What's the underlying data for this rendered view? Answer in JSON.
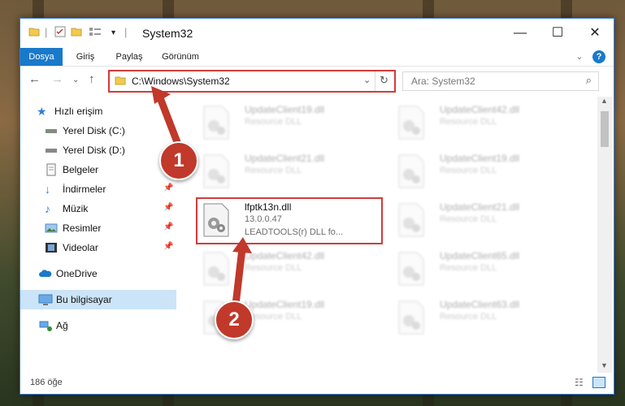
{
  "window": {
    "title": "System32",
    "minimize": "—",
    "maximize": "☐",
    "close": "✕"
  },
  "ribbon": {
    "tabs": [
      {
        "label": "Dosya",
        "active": true
      },
      {
        "label": "Giriş",
        "active": false
      },
      {
        "label": "Paylaş",
        "active": false
      },
      {
        "label": "Görünüm",
        "active": false
      }
    ]
  },
  "address": {
    "path": "C:\\Windows\\System32",
    "search_placeholder": "Ara: System32"
  },
  "sidebar": {
    "items": [
      {
        "label": "Hızlı erişim",
        "icon": "star-icon",
        "pinned": false
      },
      {
        "label": "Yerel Disk (C:)",
        "icon": "drive-icon",
        "pinned": false
      },
      {
        "label": "Yerel Disk (D:)",
        "icon": "drive-icon",
        "pinned": false
      },
      {
        "label": "Belgeler",
        "icon": "documents-icon",
        "pinned": false
      },
      {
        "label": "İndirmeler",
        "icon": "download-icon",
        "pinned": true
      },
      {
        "label": "Müzik",
        "icon": "music-icon",
        "pinned": true
      },
      {
        "label": "Resimler",
        "icon": "pictures-icon",
        "pinned": true
      },
      {
        "label": "Videolar",
        "icon": "videos-icon",
        "pinned": true
      },
      {
        "label": "OneDrive",
        "icon": "cloud-icon",
        "pinned": false
      },
      {
        "label": "Bu bilgisayar",
        "icon": "computer-icon",
        "pinned": false
      },
      {
        "label": "Ağ",
        "icon": "network-icon",
        "pinned": false
      }
    ]
  },
  "files": [
    {
      "name": "UpdateClient19.dll",
      "desc": "Resource DLL",
      "blur": true
    },
    {
      "name": "UpdateClient42.dll",
      "desc": "Resource DLL",
      "blur": true
    },
    {
      "name": "UpdateClient21.dll",
      "desc": "Resource DLL",
      "blur": true
    },
    {
      "name": "UpdateClient19.dll",
      "desc": "Resource DLL",
      "blur": true
    },
    {
      "name": "lfptk13n.dll",
      "desc": "13.0.0.47",
      "desc2": "LEADTOOLS(r) DLL fo...",
      "blur": false
    },
    {
      "name": "UpdateClient21.dll",
      "desc": "Resource DLL",
      "blur": true
    },
    {
      "name": "UpdateClient42.dll",
      "desc": "Resource DLL",
      "blur": true
    },
    {
      "name": "UpdateClient65.dll",
      "desc": "Resource DLL",
      "blur": true
    },
    {
      "name": "UpdateClient19.dll",
      "desc": "Resource DLL",
      "blur": true
    },
    {
      "name": "UpdateClient63.dll",
      "desc": "Resource DLL",
      "blur": true
    }
  ],
  "status": {
    "count": "186 öğe"
  },
  "callouts": [
    "1",
    "2"
  ],
  "colors": {
    "accent": "#1979ca",
    "highlight": "#d23b3b"
  }
}
